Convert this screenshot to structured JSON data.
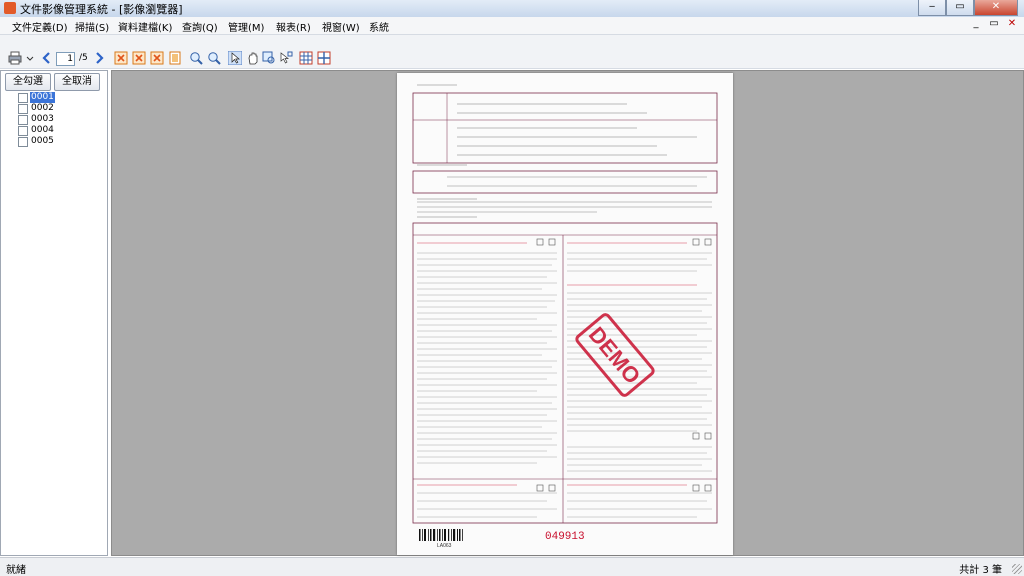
{
  "window": {
    "title": "文件影像管理系統 - [影像瀏覽器]",
    "minimize": "‒",
    "maximize": "▭",
    "close": "✕"
  },
  "menu": [
    "文件定義(D)",
    "掃描(S)",
    "資料建檔(K)",
    "查詢(Q)",
    "管理(M)",
    "報表(R)",
    "視窗(W)",
    "系統"
  ],
  "mdi": {
    "minimize": "_",
    "restore": "▭",
    "close": "✕"
  },
  "toolbar": {
    "page_current": "1",
    "page_total": "/5"
  },
  "left_panel": {
    "select_all": "全勾選",
    "deselect_all": "全取消",
    "items": [
      {
        "label": "0001",
        "selected": true
      },
      {
        "label": "0002",
        "selected": false
      },
      {
        "label": "0003",
        "selected": false
      },
      {
        "label": "0004",
        "selected": false
      },
      {
        "label": "0005",
        "selected": false
      }
    ]
  },
  "document": {
    "stamp": "DEMO",
    "serial": "049913",
    "barcode_text": "LA063",
    "colors": {
      "stamp": "#c8102e",
      "border": "#7a2b4b"
    }
  },
  "status": {
    "left": "就緒",
    "right": "共計 3 筆"
  }
}
